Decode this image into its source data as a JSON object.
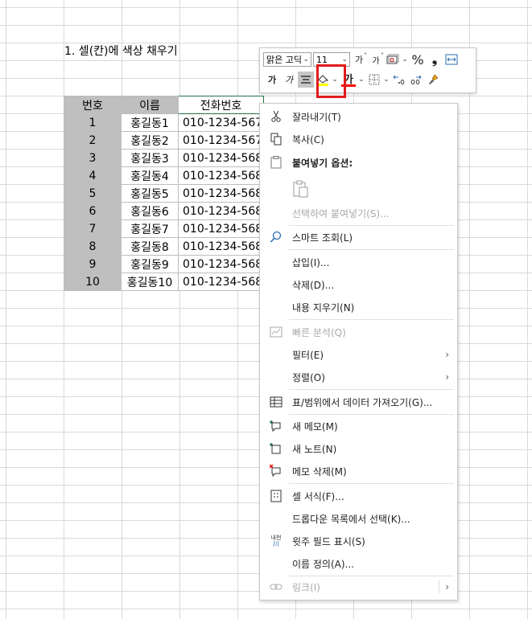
{
  "sheet": {
    "title": "1. 셀(칸)에 색상 채우기",
    "headers": [
      "번호",
      "이름",
      "전화번호"
    ],
    "rows": [
      {
        "num": "1",
        "name": "홍길동1",
        "phone": "010-1234-567"
      },
      {
        "num": "2",
        "name": "홍길동2",
        "phone": "010-1234-567"
      },
      {
        "num": "3",
        "name": "홍길동3",
        "phone": "010-1234-568"
      },
      {
        "num": "4",
        "name": "홍길동4",
        "phone": "010-1234-568"
      },
      {
        "num": "5",
        "name": "홍길동5",
        "phone": "010-1234-568"
      },
      {
        "num": "6",
        "name": "홍길동6",
        "phone": "010-1234-568"
      },
      {
        "num": "7",
        "name": "홍길동7",
        "phone": "010-1234-568"
      },
      {
        "num": "8",
        "name": "홍길동8",
        "phone": "010-1234-568"
      },
      {
        "num": "9",
        "name": "홍길동9",
        "phone": "010-1234-568"
      },
      {
        "num": "10",
        "name": "홍길동10",
        "phone": "010-1234-568"
      }
    ]
  },
  "mini_toolbar": {
    "font_name": "맑은 고딕",
    "font_size": "11",
    "grow_font": "가",
    "shrink_font": "가",
    "bold": "가",
    "italic": "가",
    "percent": "%",
    "comma": "❟",
    "font_color_glyph": "가",
    "fill_color": "#FFFF00",
    "font_color": "#FF0000",
    "highlight_color": "#E31B1B"
  },
  "context_menu": {
    "items": [
      {
        "label": "잘라내기(T)",
        "icon": "scissors-icon",
        "disabled": false
      },
      {
        "label": "복사(C)",
        "icon": "copy-icon",
        "disabled": false
      },
      {
        "label": "붙여넣기 옵션:",
        "icon": "paste-icon",
        "disabled": false,
        "bold": true
      },
      {
        "label": "",
        "icon": "paste-option-icon",
        "disabled": false
      },
      {
        "label": "선택하여 붙여넣기(S)...",
        "icon": "",
        "disabled": true
      },
      {
        "label": "스마트 조회(L)",
        "icon": "smart-lookup-icon",
        "disabled": false
      },
      {
        "label": "삽입(I)...",
        "icon": "",
        "disabled": false
      },
      {
        "label": "삭제(D)...",
        "icon": "",
        "disabled": false
      },
      {
        "label": "내용 지우기(N)",
        "icon": "",
        "disabled": false
      },
      {
        "label": "빠른 분석(Q)",
        "icon": "quick-analysis-icon",
        "disabled": true
      },
      {
        "label": "필터(E)",
        "icon": "",
        "disabled": false,
        "submenu": true
      },
      {
        "label": "정렬(O)",
        "icon": "",
        "disabled": false,
        "submenu": true
      },
      {
        "label": "표/범위에서 데이터 가져오기(G)...",
        "icon": "table-icon",
        "disabled": false
      },
      {
        "label": "새 메모(M)",
        "icon": "new-comment-icon",
        "disabled": false
      },
      {
        "label": "새 노트(N)",
        "icon": "new-note-icon",
        "disabled": false
      },
      {
        "label": "메모 삭제(M)",
        "icon": "delete-comment-icon",
        "disabled": false
      },
      {
        "label": "셀 서식(F)...",
        "icon": "format-cells-icon",
        "disabled": false
      },
      {
        "label": "드롭다운 목록에서 선택(K)...",
        "icon": "",
        "disabled": false
      },
      {
        "label": "윗주 필드 표시(S)",
        "icon": "phonetic-icon",
        "disabled": false
      },
      {
        "label": "이름 정의(A)...",
        "icon": "",
        "disabled": false
      },
      {
        "label": "링크(I)",
        "icon": "link-icon",
        "disabled": true,
        "submenu": true
      }
    ],
    "phonetic_icon_text": "내천"
  }
}
